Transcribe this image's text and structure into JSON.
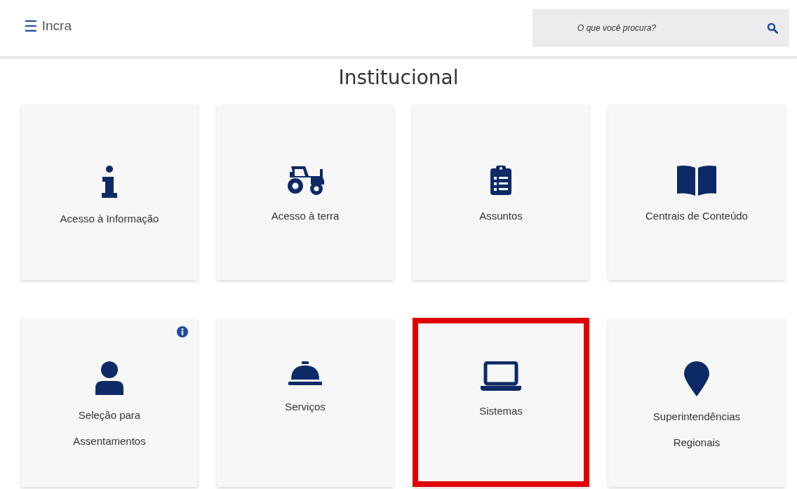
{
  "header": {
    "menu_icon": "☰",
    "brand": "Incra",
    "search": {
      "placeholder": "O que você procura?"
    }
  },
  "section_title": "Institucional",
  "cards": [
    {
      "kind": "info",
      "label": "Acesso à Informação",
      "highlighted": false,
      "info_badge": false
    },
    {
      "kind": "tractor",
      "label": "Acesso à terra",
      "highlighted": false,
      "info_badge": false
    },
    {
      "kind": "clipboard",
      "label": "Assuntos",
      "highlighted": false,
      "info_badge": false
    },
    {
      "kind": "book",
      "label": "Centrais de Conteúdo",
      "highlighted": false,
      "info_badge": false
    },
    {
      "kind": "person",
      "label": "Seleção para Assentamentos",
      "highlighted": false,
      "info_badge": true
    },
    {
      "kind": "bell",
      "label": "Serviços",
      "highlighted": false,
      "info_badge": false
    },
    {
      "kind": "laptop",
      "label": "Sistemas",
      "highlighted": true,
      "info_badge": false
    },
    {
      "kind": "pin",
      "label": "Superintendências Regionais",
      "highlighted": false,
      "info_badge": false
    }
  ]
}
